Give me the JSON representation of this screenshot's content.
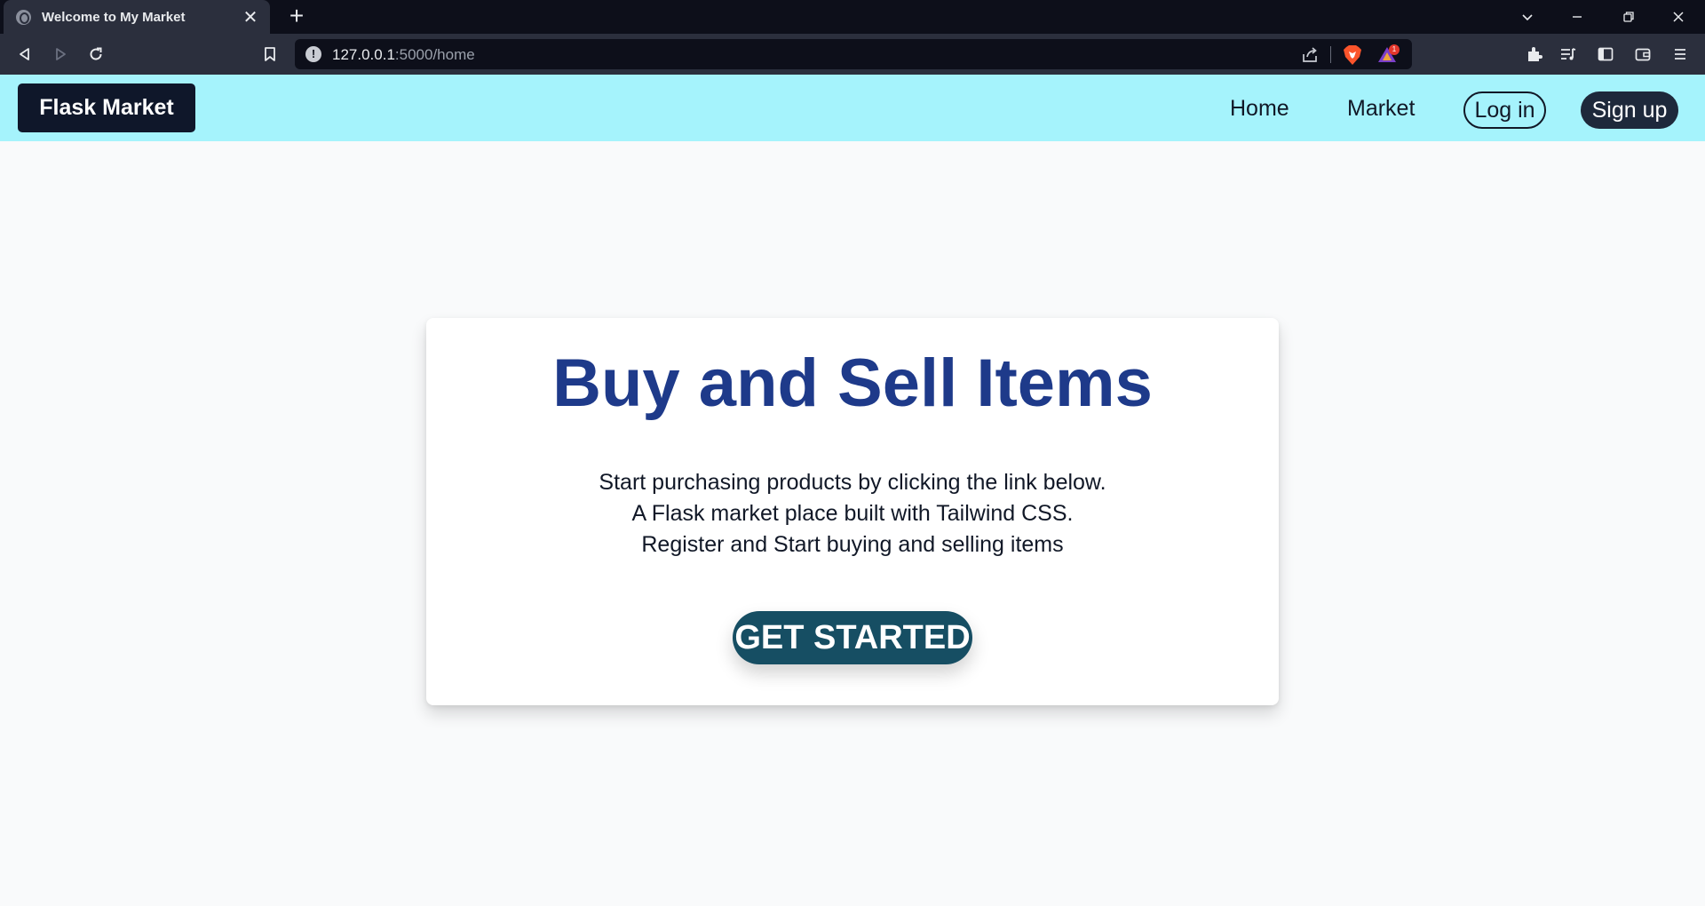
{
  "browser": {
    "tab": {
      "title": "Welcome to My Market",
      "favicon": "globe-icon"
    },
    "new_tab_symbol": "+",
    "close_symbol": "✕",
    "url": {
      "host": "127.0.0.1",
      "rest": ":5000/home"
    },
    "rewards_badge": "1",
    "colors": {
      "titlebar": "#0d0f1a",
      "toolbar": "#2b2f3d",
      "urlbar": "#0d0f1a"
    }
  },
  "site": {
    "brand": "Flask Market",
    "nav": {
      "home": "Home",
      "market": "Market",
      "login": "Log in",
      "signup": "Sign up"
    },
    "colors": {
      "navbar": "#a5f3fc",
      "brand_bg": "#0f172a",
      "title": "#1e3a8a",
      "cta": "#164e63"
    }
  },
  "hero": {
    "title": "Buy and Sell Items",
    "lines": [
      "Start purchasing products by clicking the link below.",
      "A Flask market place built with Tailwind CSS.",
      "Register and Start buying and selling items"
    ],
    "cta": "GET STARTED"
  }
}
